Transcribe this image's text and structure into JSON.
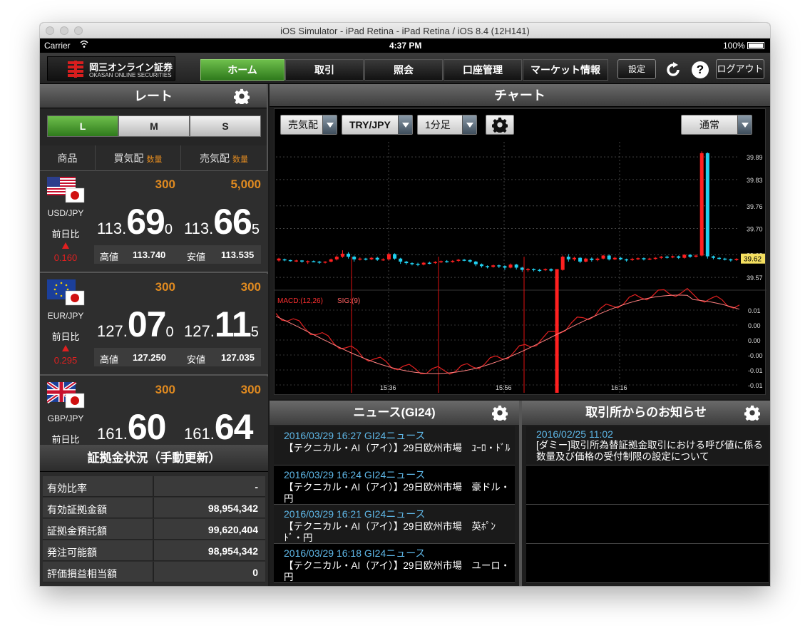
{
  "window": {
    "title": "iOS Simulator - iPad Retina - iPad Retina / iOS 8.4 (12H141)"
  },
  "status": {
    "carrier": "Carrier",
    "time": "4:37 PM",
    "battery": "100%"
  },
  "nav": {
    "logo_jp": "岡三オンライン証券",
    "logo_en": "OKASAN ONLINE SECURITIES",
    "tabs": [
      "ホーム",
      "取引",
      "照会",
      "口座管理",
      "マーケット情報"
    ],
    "settings": "設定",
    "logout": "ログアウト",
    "help": "?"
  },
  "rate": {
    "title": "レート",
    "sizes": [
      "L",
      "M",
      "S"
    ],
    "columns": {
      "product": "商品",
      "bid": "買気配",
      "ask": "売気配",
      "qty": "数量"
    },
    "diff_label": "前日比",
    "high_label": "高値",
    "low_label": "安値",
    "items": [
      {
        "pair": "USD/JPY",
        "bid_qty": "300",
        "ask_qty": "5,000",
        "bid_s": "113.",
        "bid_b": "69",
        "bid_t": "0",
        "ask_s": "113.",
        "ask_b": "66",
        "ask_t": "5",
        "change": "0.160",
        "high": "113.740",
        "low": "113.535"
      },
      {
        "pair": "EUR/JPY",
        "bid_qty": "300",
        "ask_qty": "300",
        "bid_s": "127.",
        "bid_b": "07",
        "bid_t": "0",
        "ask_s": "127.",
        "ask_b": "11",
        "ask_t": "5",
        "change": "0.295",
        "high": "127.250",
        "low": "127.035"
      },
      {
        "pair": "GBP/JPY",
        "bid_qty": "300",
        "ask_qty": "300",
        "bid_s": "161.",
        "bid_b": "60",
        "bid_t": "",
        "ask_s": "161.",
        "ask_b": "64",
        "ask_t": "",
        "change": "",
        "high": "",
        "low": ""
      }
    ]
  },
  "margin": {
    "title": "証拠金状況（手動更新）",
    "rows": [
      {
        "label": "有効比率",
        "value": "-"
      },
      {
        "label": "有効証拠金額",
        "value": "98,954,342"
      },
      {
        "label": "証拠金預託額",
        "value": "99,620,404"
      },
      {
        "label": "発注可能額",
        "value": "98,954,342"
      },
      {
        "label": "評価損益相当額",
        "value": "0"
      }
    ]
  },
  "chart": {
    "title": "チャート",
    "side": "売気配",
    "symbol": "TRY/JPY",
    "interval": "1分足",
    "mode": "通常",
    "macd_label": "MACD:(12,26)",
    "sig_label": "SIG:(9)"
  },
  "chart_data": {
    "type": "candlestick",
    "price_ticks": [
      "39.89",
      "39.83",
      "39.76",
      "39.70",
      "39.63",
      "39.57"
    ],
    "last_price": "39.62",
    "macd_ticks": [
      "0.01",
      "0.00",
      "0.00",
      "-0.00",
      "-0.01",
      "-0.01"
    ],
    "time_ticks": [
      "15:36",
      "15:56",
      "16:16"
    ],
    "ylim": [
      39.54,
      39.93
    ],
    "candles": [
      [
        39.615,
        39.62,
        39.612,
        39.622
      ],
      [
        39.618,
        39.616,
        39.613,
        39.62
      ],
      [
        39.616,
        39.614,
        39.612,
        39.617
      ],
      [
        39.614,
        39.615,
        39.611,
        39.617
      ],
      [
        39.615,
        39.612,
        39.609,
        39.616
      ],
      [
        39.612,
        39.613,
        39.606,
        39.615
      ],
      [
        39.613,
        39.612,
        39.61,
        39.615
      ],
      [
        39.612,
        39.61,
        39.606,
        39.614
      ],
      [
        39.61,
        39.612,
        39.607,
        39.613
      ],
      [
        39.612,
        39.618,
        39.61,
        39.62
      ],
      [
        39.618,
        39.625,
        39.615,
        39.628
      ],
      [
        39.625,
        39.633,
        39.622,
        39.642
      ],
      [
        39.633,
        39.625,
        39.62,
        39.637
      ],
      [
        39.625,
        39.618,
        39.612,
        39.628
      ],
      [
        39.618,
        39.62,
        39.615,
        39.623
      ],
      [
        39.62,
        39.618,
        39.615,
        39.622
      ],
      [
        39.618,
        39.622,
        39.616,
        39.624
      ],
      [
        39.622,
        39.617,
        39.614,
        39.625
      ],
      [
        39.617,
        39.618,
        39.614,
        39.621
      ],
      [
        39.618,
        39.632,
        39.615,
        39.635
      ],
      [
        39.632,
        39.62,
        39.617,
        39.634
      ],
      [
        39.62,
        39.612,
        39.606,
        39.622
      ],
      [
        39.612,
        39.608,
        39.604,
        39.614
      ],
      [
        39.608,
        39.606,
        39.602,
        39.61
      ],
      [
        39.606,
        39.604,
        39.6,
        39.609
      ],
      [
        39.604,
        39.609,
        39.602,
        39.611
      ],
      [
        39.609,
        39.608,
        39.605,
        39.612
      ],
      [
        39.608,
        39.611,
        39.606,
        39.613
      ],
      [
        39.611,
        39.613,
        39.608,
        39.615
      ],
      [
        39.613,
        39.612,
        39.609,
        39.616
      ],
      [
        39.612,
        39.614,
        39.609,
        39.616
      ],
      [
        39.614,
        39.617,
        39.611,
        39.619
      ],
      [
        39.617,
        39.616,
        39.613,
        39.619
      ],
      [
        39.616,
        39.612,
        39.609,
        39.618
      ],
      [
        39.612,
        39.605,
        39.6,
        39.614
      ],
      [
        39.605,
        39.6,
        39.596,
        39.607
      ],
      [
        39.6,
        39.598,
        39.594,
        39.602
      ],
      [
        39.598,
        39.602,
        39.596,
        39.604
      ],
      [
        39.602,
        39.6,
        39.595,
        39.604
      ],
      [
        39.6,
        39.596,
        39.59,
        39.602
      ],
      [
        39.596,
        39.604,
        39.594,
        39.607
      ],
      [
        39.604,
        39.596,
        39.591,
        39.606
      ],
      [
        39.596,
        39.59,
        39.585,
        39.598
      ],
      [
        39.59,
        39.592,
        39.585,
        39.595
      ],
      [
        39.592,
        39.59,
        39.586,
        39.594
      ],
      [
        39.59,
        39.589,
        39.585,
        39.593
      ],
      [
        39.589,
        39.592,
        39.587,
        39.594
      ],
      [
        39.592,
        39.588,
        39.585,
        39.594
      ],
      [
        39.588,
        39.59,
        39.4,
        39.592
      ],
      [
        39.59,
        39.625,
        39.588,
        39.628
      ],
      [
        39.625,
        39.618,
        39.612,
        39.632
      ],
      [
        39.618,
        39.622,
        39.614,
        39.625
      ],
      [
        39.622,
        39.612,
        39.608,
        39.624
      ],
      [
        39.612,
        39.62,
        39.61,
        39.622
      ],
      [
        39.62,
        39.616,
        39.612,
        39.623
      ],
      [
        39.616,
        39.62,
        39.613,
        39.623
      ],
      [
        39.62,
        39.628,
        39.618,
        39.63
      ],
      [
        39.628,
        39.618,
        39.615,
        39.631
      ],
      [
        39.618,
        39.622,
        39.616,
        39.625
      ],
      [
        39.622,
        39.618,
        39.616,
        39.624
      ],
      [
        39.618,
        39.616,
        39.612,
        39.62
      ],
      [
        39.616,
        39.619,
        39.614,
        39.622
      ],
      [
        39.619,
        39.621,
        39.616,
        39.623
      ],
      [
        39.621,
        39.618,
        39.615,
        39.623
      ],
      [
        39.618,
        39.62,
        39.616,
        39.622
      ],
      [
        39.62,
        39.622,
        39.617,
        39.624
      ],
      [
        39.622,
        39.625,
        39.619,
        39.627
      ],
      [
        39.625,
        39.623,
        39.62,
        39.628
      ],
      [
        39.623,
        39.626,
        39.621,
        39.628
      ],
      [
        39.626,
        39.622,
        39.619,
        39.628
      ],
      [
        39.622,
        39.63,
        39.62,
        39.632
      ],
      [
        39.63,
        39.625,
        39.622,
        39.632
      ],
      [
        39.625,
        39.628,
        39.623,
        39.631
      ],
      [
        39.628,
        39.9,
        39.626,
        39.905
      ],
      [
        39.9,
        39.626,
        39.62,
        39.902
      ],
      [
        39.626,
        39.622,
        39.618,
        39.628
      ],
      [
        39.622,
        39.62,
        39.617,
        39.624
      ],
      [
        39.62,
        39.618,
        39.615,
        39.622
      ],
      [
        39.618,
        39.616,
        39.612,
        39.62
      ],
      [
        39.616,
        39.619,
        39.614,
        39.621
      ]
    ]
  },
  "news": {
    "title": "ニュース(GI24)",
    "items": [
      {
        "date": "2016/03/29 16:27 GI24ニュース",
        "text": "【テクニカル・AI（アイ）】29日欧州市場　ﾕｰﾛ・ﾄﾞﾙ"
      },
      {
        "date": "2016/03/29 16:24 GI24ニュース",
        "text": "【テクニカル・AI（アイ）】29日欧州市場　豪ドル・円"
      },
      {
        "date": "2016/03/29 16:21 GI24ニュース",
        "text": "【テクニカル・AI（アイ）】29日欧州市場　英ﾎﾟﾝﾄﾞ・円"
      },
      {
        "date": "2016/03/29 16:18 GI24ニュース",
        "text": "【テクニカル・AI（アイ）】29日欧州市場　ユーロ・円"
      }
    ]
  },
  "notice": {
    "title": "取引所からのお知らせ",
    "items": [
      {
        "date": "2016/02/25 11:02",
        "text": "[ダミー]取引所為替証拠金取引における呼び値に係る数量及び価格の受付制限の設定について"
      }
    ]
  }
}
